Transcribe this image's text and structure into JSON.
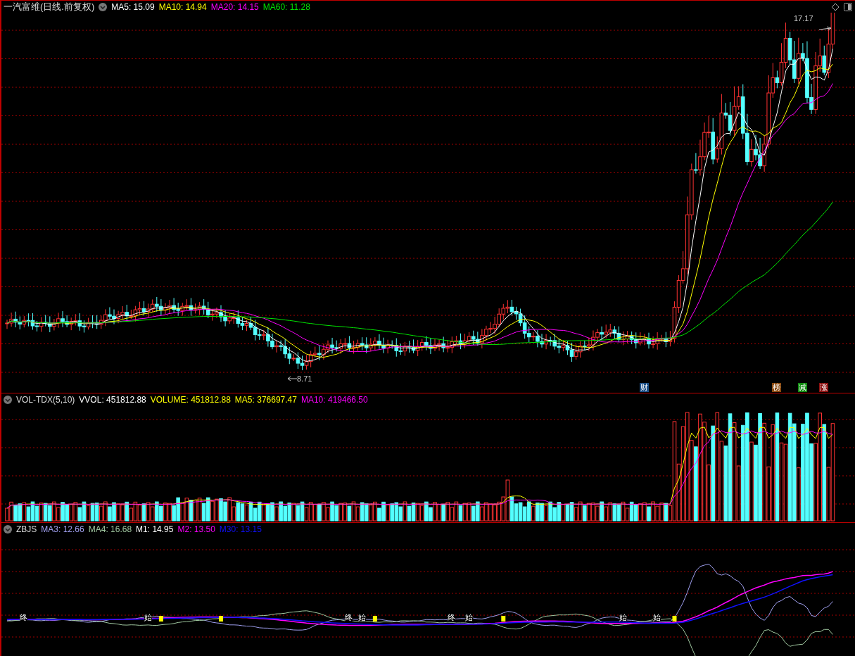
{
  "main_panel": {
    "title": "一汽富维(日线.前复权)",
    "indicators": [
      {
        "label": "MA5: 15.09",
        "color": "#ffffff"
      },
      {
        "label": "MA10: 14.94",
        "color": "#ffff00"
      },
      {
        "label": "MA20: 14.15",
        "color": "#ff00ff"
      },
      {
        "label": "MA60: 11.28",
        "color": "#00e600"
      }
    ],
    "high_label": "17.17",
    "low_label": "8.71",
    "badges": [
      {
        "text": "财",
        "color": "#1c4f86"
      },
      {
        "text": "榜",
        "color": "#8a4a10"
      },
      {
        "text": "减",
        "color": "#108a10"
      },
      {
        "text": "涨",
        "color": "#8a1010"
      }
    ]
  },
  "volume_panel": {
    "name": "VOL-TDX(5,10)",
    "indicators": [
      {
        "label": "VVOL: 451812.88",
        "color": "#ffffff"
      },
      {
        "label": "VOLUME: 451812.88",
        "color": "#ffff00"
      },
      {
        "label": "MA5: 376697.47",
        "color": "#ffff00"
      },
      {
        "label": "MA10: 419466.50",
        "color": "#ff00ff"
      }
    ]
  },
  "zbjs_panel": {
    "name": "ZBJS",
    "indicators": [
      {
        "label": "MA3: 12.66",
        "color": "#a0a0f0"
      },
      {
        "label": "MA4: 16.68",
        "color": "#a0c8a0"
      },
      {
        "label": "M1: 14.95",
        "color": "#ffffff"
      },
      {
        "label": "M2: 13.50",
        "color": "#ff00ff"
      },
      {
        "label": "M30: 13.15",
        "color": "#1010ff"
      }
    ],
    "signals": [
      {
        "text": "终"
      },
      {
        "text": "始"
      },
      {
        "text": "终"
      },
      {
        "text": "始"
      },
      {
        "text": "终"
      },
      {
        "text": "始"
      },
      {
        "text": "始"
      },
      {
        "text": "始"
      }
    ]
  }
}
